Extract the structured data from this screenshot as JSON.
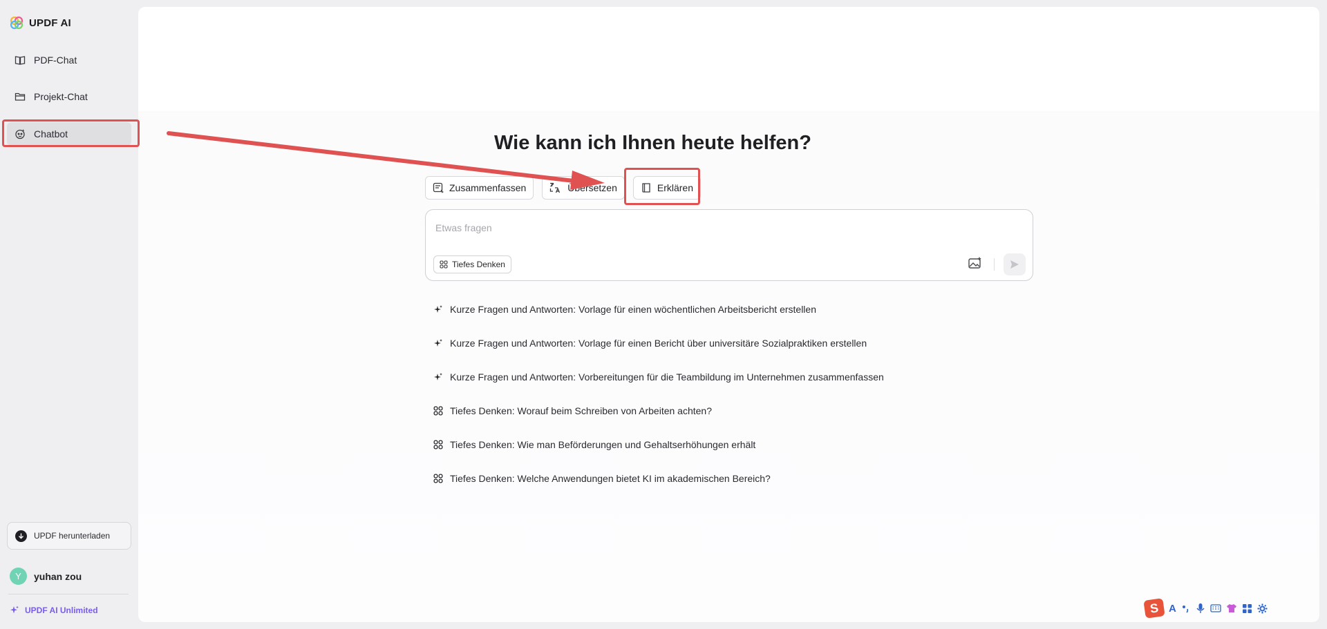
{
  "brand": {
    "name": "UPDF AI",
    "icon": "updf-flower-logo"
  },
  "sidebar": {
    "items": [
      {
        "label": "PDF-Chat",
        "icon": "open-book-icon"
      },
      {
        "label": "Projekt-Chat",
        "icon": "folder-icon"
      },
      {
        "label": "Chatbot",
        "icon": "bot-face-icon",
        "active": true
      }
    ],
    "download_label": "UPDF herunterladen",
    "user": {
      "initial": "Y",
      "name": "yuhan zou"
    },
    "plan_label": "UPDF AI Unlimited"
  },
  "main": {
    "headline": "Wie kann ich Ihnen heute helfen?",
    "chips": [
      {
        "label": "Zusammenfassen",
        "icon": "summarize-icon"
      },
      {
        "label": "Übersetzen",
        "icon": "translate-icon"
      },
      {
        "label": "Erklären",
        "icon": "book-icon"
      }
    ],
    "composer": {
      "placeholder": "Etwas fragen",
      "deep_thinking_label": "Tiefes Denken"
    },
    "suggestions": [
      {
        "icon": "sparkle-icon",
        "text": "Kurze Fragen und Antworten: Vorlage für einen wöchentlichen Arbeitsbericht erstellen"
      },
      {
        "icon": "sparkle-icon",
        "text": "Kurze Fragen und Antworten: Vorlage für einen Bericht über universitäre Sozialpraktiken erstellen"
      },
      {
        "icon": "sparkle-icon",
        "text": "Kurze Fragen und Antworten: Vorbereitungen für die Teambildung im Unternehmen zusammenfassen"
      },
      {
        "icon": "deep-think-icon",
        "text": "Tiefes Denken: Worauf beim Schreiben von Arbeiten achten?"
      },
      {
        "icon": "deep-think-icon",
        "text": "Tiefes Denken: Wie man Beförderungen und Gehaltserhöhungen erhält"
      },
      {
        "icon": "deep-think-icon",
        "text": "Tiefes Denken: Welche Anwendungen bietet KI im akademischen Bereich?"
      }
    ]
  },
  "tray": {
    "logo_letter": "S",
    "ime_letter": "A"
  },
  "annotation_colors": {
    "highlight": "#e05252"
  }
}
